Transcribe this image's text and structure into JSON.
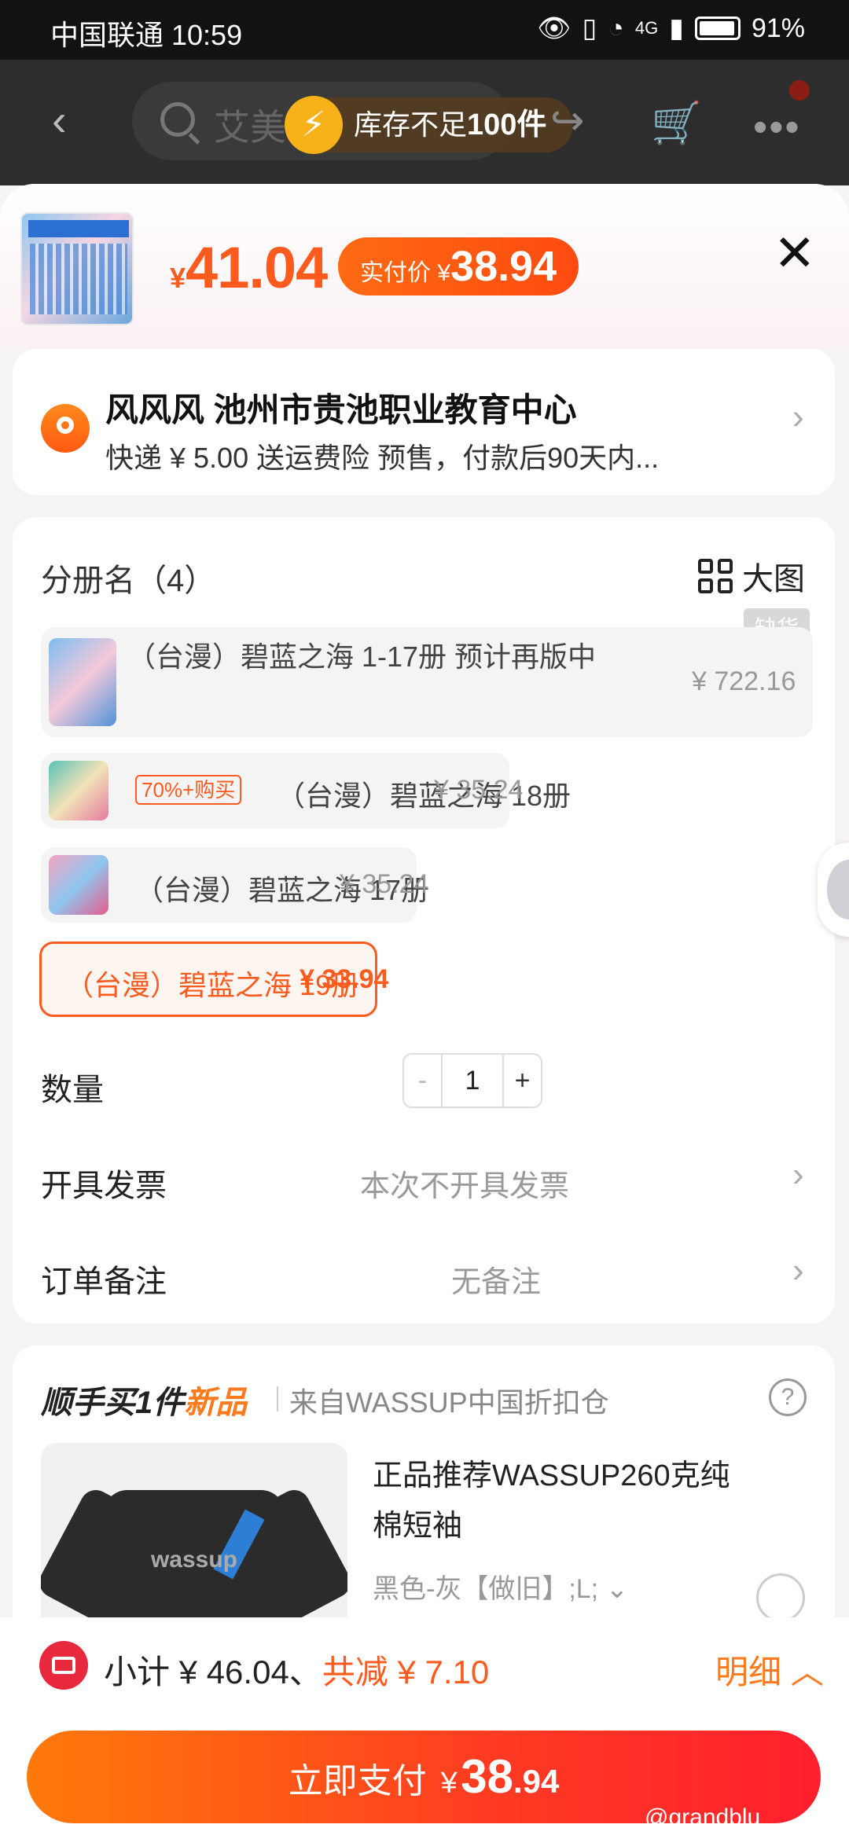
{
  "status_bar": {
    "carrier_time": "中国联通 10:59",
    "network": "4G",
    "battery": "91%"
  },
  "header": {
    "search_query": "艾美",
    "stock_tip_prefix": "库存不足",
    "stock_tip_num": "100件"
  },
  "product": {
    "currency": "¥",
    "price": "41.04",
    "pay_label": "实付价 ¥",
    "pay_amount": "38.94"
  },
  "address": {
    "title": "风风风 池州市贵池职业教育中心",
    "subtitle": "快递 ¥ 5.00  送运费险  预售，付款后90天内..."
  },
  "spec": {
    "title": "分册名（4）",
    "big_image": "大图",
    "out_of_stock": "缺货",
    "options": [
      {
        "label": "（台漫）碧蓝之海 1-17册 预计再版中",
        "price": "¥ 722.16"
      },
      {
        "tag": "70%+购买",
        "label": "（台漫）碧蓝之海 18册",
        "price": "¥ 35.24"
      },
      {
        "label": "（台漫）碧蓝之海 17册",
        "price": "¥ 35.24"
      },
      {
        "label": "（台漫）碧蓝之海 19册",
        "price": "¥ 33.94"
      }
    ],
    "selected_index": 3
  },
  "quantity": {
    "label": "数量",
    "minus": "-",
    "value": "1",
    "plus": "+"
  },
  "invoice": {
    "label": "开具发票",
    "value": "本次不开具发票"
  },
  "note": {
    "label": "订单备注",
    "value": "无备注"
  },
  "upsell": {
    "title": "顺手买1件",
    "title_new": "新品",
    "from": "来自WASSUP中国折扣仓",
    "help": "?",
    "image_logo": "wassup",
    "name": "正品推荐WASSUP260克纯棉短袖",
    "sku": "黑色-灰【做旧】;L;"
  },
  "bottom": {
    "subtotal": "小计 ¥ 46.04、",
    "discount": "共减 ¥ 7.10",
    "detail": "明细",
    "pay_label": "立即支付",
    "pay_currency": "¥",
    "pay_int": "38",
    "pay_dec": ".94",
    "watermark": "@grandblu"
  },
  "colors": {
    "accent": "#fd5a1e",
    "pay_gradient_end": "#ff1f2e"
  }
}
